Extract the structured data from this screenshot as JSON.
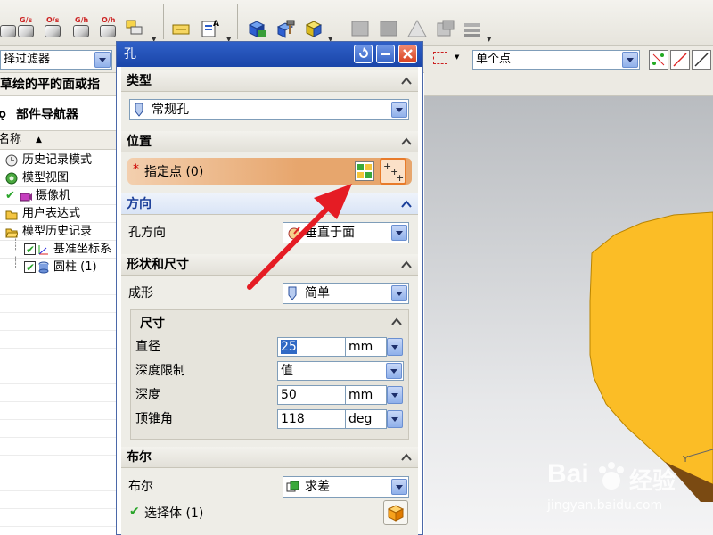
{
  "toolbar": {
    "selection_labels": [
      "G/s",
      "O/s",
      "G/h",
      "O/h"
    ]
  },
  "filter_bar": {
    "type_filter": "择过滤器",
    "selection_scope": "单个点"
  },
  "navigator": {
    "hint": "草绘的平的面或指",
    "title": "部件导航器",
    "column_header": "名称",
    "items": [
      {
        "label": "历史记录模式",
        "icon": "clock-icon"
      },
      {
        "label": "模型视图",
        "icon": "model-views-icon"
      },
      {
        "label": "摄像机",
        "icon": "camera-icon",
        "checked": true
      },
      {
        "label": "用户表达式",
        "icon": "folder-icon"
      },
      {
        "label": "模型历史记录",
        "icon": "open-folder-icon"
      },
      {
        "label": "基准坐标系",
        "icon": "datum-csys-icon",
        "checked": true
      },
      {
        "label": "圆柱 (1)",
        "icon": "cylinder-icon",
        "checked": true
      }
    ]
  },
  "dialog": {
    "title": "孔",
    "sections": {
      "type": {
        "header": "类型",
        "value": "常规孔"
      },
      "position": {
        "header": "位置",
        "required_marker": "*",
        "specify_point": "指定点 (0)"
      },
      "direction": {
        "header": "方向",
        "label": "孔方向",
        "value": "垂直于面"
      },
      "shape": {
        "header": "形状和尺寸",
        "form_label": "成形",
        "form_value": "简单",
        "dimensions_header": "尺寸",
        "fields": [
          {
            "label": "直径",
            "value": "25",
            "unit": "mm"
          },
          {
            "label": "深度限制",
            "value": "值",
            "unit": ""
          },
          {
            "label": "深度",
            "value": "50",
            "unit": "mm"
          },
          {
            "label": "顶锥角",
            "value": "118",
            "unit": "deg"
          }
        ]
      },
      "boolean": {
        "header": "布尔",
        "label": "布尔",
        "value": "求差",
        "select_body": "选择体 (1)"
      }
    }
  },
  "watermark": {
    "brand": "Bai",
    "brand_suffix": "经验",
    "url": "jingyan.baidu.com"
  },
  "colors": {
    "dialog_title": "#2a57c0",
    "specify_point_bg": "#e7a66d",
    "cylinder": "#fbbd26",
    "arrow": "#e51c24"
  }
}
